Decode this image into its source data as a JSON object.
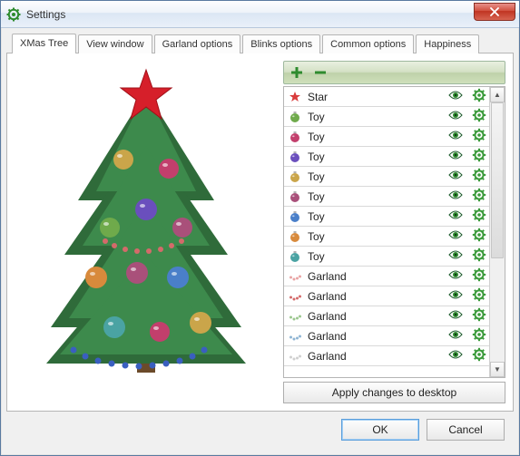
{
  "window": {
    "title": "Settings",
    "close_icon": "close-icon"
  },
  "tabs": [
    {
      "label": "XMas Tree",
      "active": true
    },
    {
      "label": "View window",
      "active": false
    },
    {
      "label": "Garland options",
      "active": false
    },
    {
      "label": "Blinks options",
      "active": false
    },
    {
      "label": "Common options",
      "active": false
    },
    {
      "label": "Happiness",
      "active": false
    }
  ],
  "toolbar": {
    "add_icon": "plus-icon",
    "remove_icon": "minus-icon"
  },
  "items": [
    {
      "icon": "star",
      "color": "#d93c3c",
      "label": "Star"
    },
    {
      "icon": "ball",
      "color": "#6faa4b",
      "label": "Toy"
    },
    {
      "icon": "ball",
      "color": "#c23f6c",
      "label": "Toy"
    },
    {
      "icon": "ball",
      "color": "#6a4fbd",
      "label": "Toy"
    },
    {
      "icon": "ball",
      "color": "#caa54a",
      "label": "Toy"
    },
    {
      "icon": "ball",
      "color": "#a9507a",
      "label": "Toy"
    },
    {
      "icon": "ball",
      "color": "#4a7fc9",
      "label": "Toy"
    },
    {
      "icon": "ball",
      "color": "#d88a3c",
      "label": "Toy"
    },
    {
      "icon": "ball",
      "color": "#4aa3a3",
      "label": "Toy"
    },
    {
      "icon": "garland",
      "color": "#e9a4a4",
      "label": "Garland"
    },
    {
      "icon": "garland",
      "color": "#d46a6a",
      "label": "Garland"
    },
    {
      "icon": "garland",
      "color": "#9cc78f",
      "label": "Garland"
    },
    {
      "icon": "garland",
      "color": "#8fb5d4",
      "label": "Garland"
    },
    {
      "icon": "garland",
      "color": "#cfcfcf",
      "label": "Garland"
    }
  ],
  "row_actions": {
    "eye_icon": "eye-icon",
    "gear_icon": "gear-icon"
  },
  "apply_button": "Apply changes to desktop",
  "footer": {
    "ok": "OK",
    "cancel": "Cancel"
  },
  "colors": {
    "accent_green": "#2e8b2e",
    "gear_green": "#3a9a3a"
  }
}
